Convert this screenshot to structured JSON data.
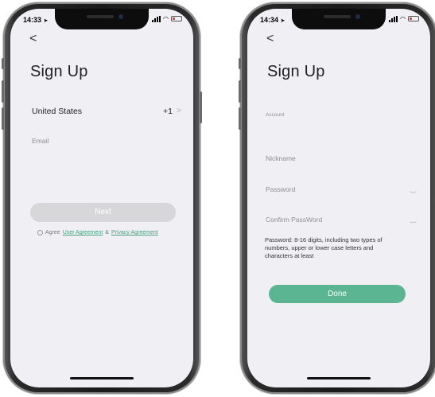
{
  "left": {
    "status_time": "14:33",
    "back": "<",
    "title": "Sign Up",
    "country": "United States",
    "country_code": "+1",
    "country_chevron": ">",
    "email_label": "Email",
    "next_label": "Next",
    "agree_prefix": "Agree",
    "user_agreement": "User Agreement",
    "amp": "&",
    "privacy_agreement": "Privacy Agreement"
  },
  "right": {
    "status_time": "14:34",
    "back": "<",
    "title": "Sign Up",
    "account_label": "Account",
    "nickname_label": "Nickname",
    "password_label": "Password",
    "confirm_label": "Confirm PassWord",
    "password_hint": "Password: 8-16 digits, including two types of numbers, upper or lower case letters and characters at least",
    "done_label": "Done"
  },
  "colors": {
    "accent": "#5cb592",
    "button_disabled": "#d7d7da",
    "screen_bg": "#efeff4",
    "link": "#4aa07d"
  },
  "icons": [
    "chevron-left-icon",
    "chevron-right-icon",
    "eye-closed-icon",
    "location-arrow-icon",
    "signal-icon",
    "wifi-icon",
    "battery-icon"
  ]
}
